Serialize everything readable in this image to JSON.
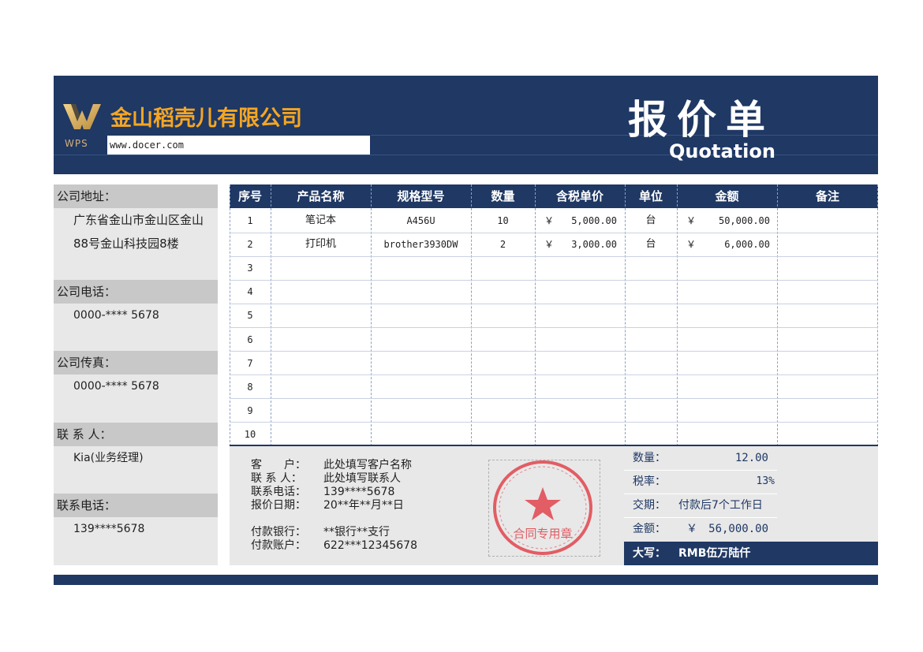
{
  "header": {
    "company_name": "金山稻壳儿有限公司",
    "logo_text": "WPS",
    "website": "www.docer.com",
    "title": "报价单",
    "subtitle": "Quotation"
  },
  "company_info": {
    "address_label": "公司地址：",
    "address_line1": "广东省金山市金山区金山",
    "address_line2": "88号金山科技园8楼",
    "phone_label": "公司电话：",
    "phone_value": "0000-**** 5678",
    "fax_label": "公司传真：",
    "fax_value": "0000-**** 5678",
    "contact_label": "联 系 人：",
    "contact_value": "Kia(业务经理)",
    "contact_phone_label": "联系电话：",
    "contact_phone_value": "139****5678"
  },
  "table": {
    "headers": [
      "序号",
      "产品名称",
      "规格型号",
      "数量",
      "含税单价",
      "单位",
      "金额",
      "备注"
    ],
    "rows": [
      {
        "no": "1",
        "name": "笔记本",
        "model": "A456U",
        "qty": "10",
        "price_symbol": "￥",
        "price": "5,000.00",
        "unit": "台",
        "amount_symbol": "￥",
        "amount": "50,000.00",
        "note": ""
      },
      {
        "no": "2",
        "name": "打印机",
        "model": "brother3930DW",
        "qty": "2",
        "price_symbol": "￥",
        "price": "3,000.00",
        "unit": "台",
        "amount_symbol": "￥",
        "amount": "6,000.00",
        "note": ""
      },
      {
        "no": "3"
      },
      {
        "no": "4"
      },
      {
        "no": "5"
      },
      {
        "no": "6"
      },
      {
        "no": "7"
      },
      {
        "no": "8"
      },
      {
        "no": "9"
      },
      {
        "no": "10"
      }
    ]
  },
  "customer": {
    "customer_label": "客　　户：",
    "customer_value": "此处填写客户名称",
    "contact_label": "联 系 人：",
    "contact_value": "此处填写联系人",
    "phone_label": "联系电话：",
    "phone_value": "139****5678",
    "date_label": "报价日期：",
    "date_value": "20**年**月**日",
    "bank_label": "付款银行：",
    "bank_value": "**银行**支行",
    "account_label": "付款账户：",
    "account_value": "622***12345678"
  },
  "seal": {
    "text": "合同专用章",
    "colors": {
      "ink": "#e0444c"
    }
  },
  "summary": {
    "qty_label": "数量：",
    "qty_value": "12.00",
    "tax_label": "税率：",
    "tax_value": "13%",
    "delivery_label": "交期：",
    "delivery_value": "付款后7个工作日",
    "amount_label": "金额：",
    "amount_symbol": "￥",
    "amount_value": "56,000.00",
    "words_label": "大写：",
    "words_value": "RMB伍万陆仟"
  },
  "colors": {
    "brand_navy": "#1f3864",
    "brand_gold": "#f5a623",
    "panel_gray": "#e8e8e8",
    "label_gray": "#c8c8c8"
  }
}
